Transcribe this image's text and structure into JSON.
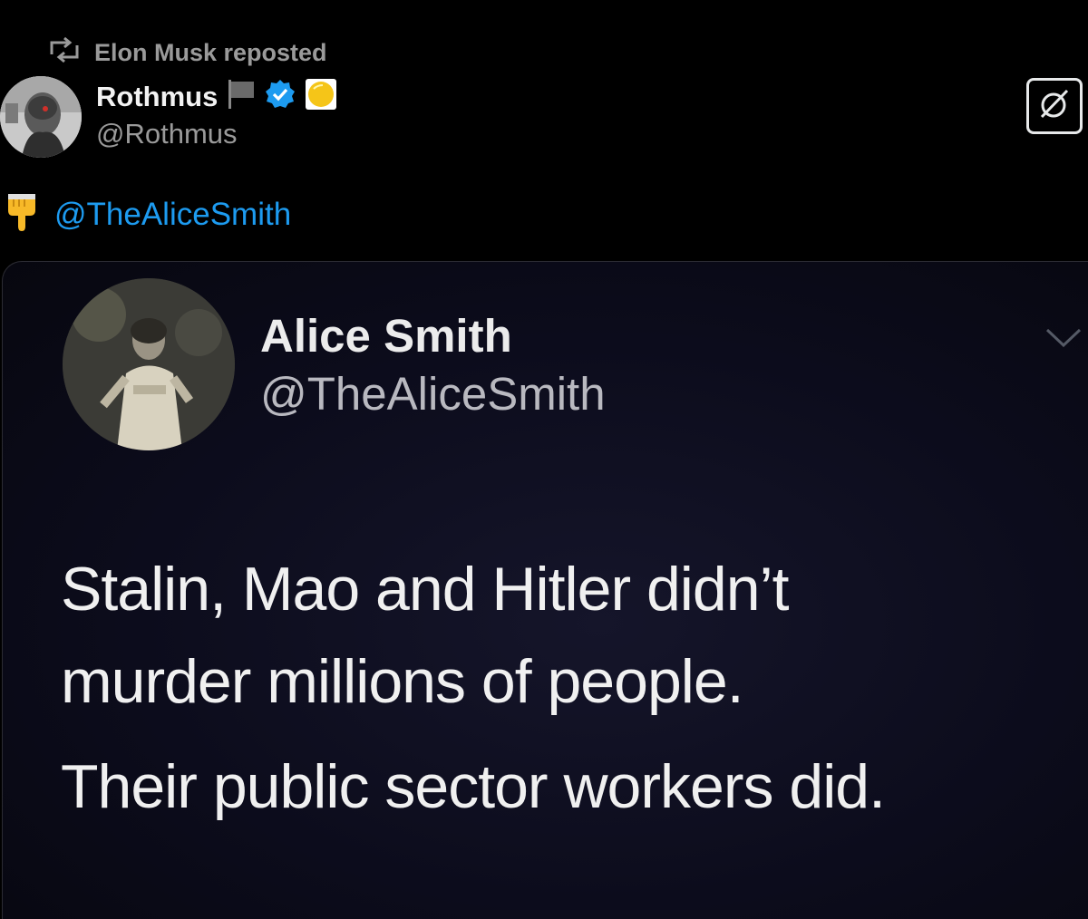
{
  "repost": {
    "icon": "repost-icon",
    "label": "Elon Musk reposted"
  },
  "author": {
    "name": "Rothmus",
    "handle": "@Rothmus",
    "badges": [
      "flag-icon",
      "verified-badge-icon",
      "yellow-circle-icon"
    ],
    "verified_color": "#1d9bf0"
  },
  "grok_button": {
    "icon": "grok-icon"
  },
  "tweet": {
    "emoji": "pointing-down-icon",
    "mention": "@TheAliceSmith",
    "mention_color": "#1d9bf0"
  },
  "embedded_post": {
    "name": "Alice Smith",
    "handle": "@TheAliceSmith",
    "chevron": "chevron-down-icon",
    "text_line1": "Stalin, Mao and Hitler didn’t",
    "text_line2": "murder millions of people.",
    "text_line3": "Their public sector workers did."
  }
}
